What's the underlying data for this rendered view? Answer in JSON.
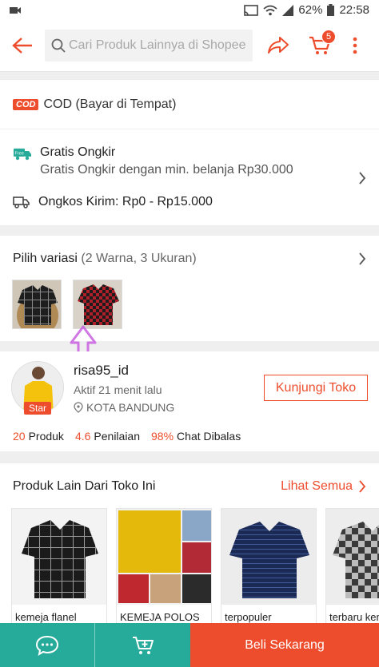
{
  "status_bar": {
    "battery": "62%",
    "time": "22:58"
  },
  "top_bar": {
    "search_placeholder": "Cari Produk Lainnya di Shopee",
    "cart_count": "5"
  },
  "cod": {
    "logo": "COD",
    "label": "COD (Bayar di Tempat)"
  },
  "shipping": {
    "free_badge": "Free",
    "free_title": "Gratis Ongkir",
    "free_sub": "Gratis Ongkir dengan min. belanja Rp30.000",
    "cost": "Ongkos Kirim: Rp0 - Rp15.000"
  },
  "variation": {
    "title": "Pilih variasi",
    "detail": "(2 Warna, 3 Ukuran)"
  },
  "shop": {
    "name": "risa95_id",
    "badge": "Star",
    "active": "Aktif 21 menit lalu",
    "location": "KOTA BANDUNG",
    "visit_label": "Kunjungi Toko",
    "stats": [
      {
        "value": "20",
        "label": "Produk"
      },
      {
        "value": "4.6",
        "label": "Penilaian"
      },
      {
        "value": "98%",
        "label": "Chat Dibalas"
      }
    ]
  },
  "others": {
    "title": "Produk Lain Dari Toko Ini",
    "link": "Lihat Semua",
    "products": [
      {
        "name": "kemeja flanel"
      },
      {
        "name": "KEMEJA POLOS"
      },
      {
        "name": "terpopuler"
      },
      {
        "name": "terbaru kemeja"
      }
    ]
  },
  "bottom_bar": {
    "buy_label": "Beli Sekarang"
  },
  "colors": {
    "accent": "#ee4d2d",
    "teal": "#26aa99"
  },
  "icons": [
    "back-arrow-icon",
    "search-icon",
    "share-icon",
    "cart-icon",
    "more-icon",
    "truck-icon",
    "chevron-right-icon",
    "location-pin-icon",
    "chat-icon",
    "add-to-cart-icon"
  ]
}
